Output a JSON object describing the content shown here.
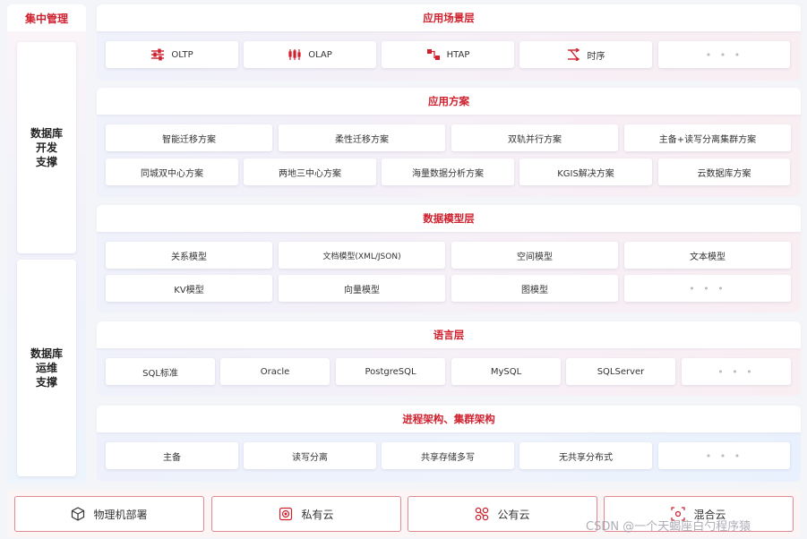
{
  "left": {
    "header": "集中管理",
    "dev_support": "数据库\n开发\n支撑",
    "ops_support": "数据库\n运维\n支撑"
  },
  "scenario_layer": {
    "title": "应用场景层",
    "items": [
      {
        "label": "OLTP",
        "icon": "sliders-icon"
      },
      {
        "label": "OLAP",
        "icon": "candlestick-icon"
      },
      {
        "label": "HTAP",
        "icon": "flow-icon"
      },
      {
        "label": "时序",
        "icon": "shuffle-icon"
      },
      {
        "label": "• • •",
        "icon": ""
      }
    ]
  },
  "solution_layer": {
    "title": "应用方案",
    "row1": [
      "智能迁移方案",
      "柔性迁移方案",
      "双轨并行方案",
      "主备+读写分离集群方案"
    ],
    "row2": [
      "同城双中心方案",
      "两地三中心方案",
      "海量数据分析方案",
      "KGIS解决方案",
      "云数据库方案"
    ]
  },
  "model_layer": {
    "title": "数据模型层",
    "row1": [
      "关系模型",
      "文档模型(XML/JSON)",
      "空间模型",
      "文本模型"
    ],
    "row2": [
      "KV模型",
      "向量模型",
      "图模型",
      "• • •"
    ]
  },
  "language_layer": {
    "title": "语言层",
    "items": [
      "SQL标准",
      "Oracle",
      "PostgreSQL",
      "MySQL",
      "SQLServer",
      "• • •"
    ]
  },
  "arch_layer": {
    "title": "进程架构、集群架构",
    "items": [
      "主备",
      "读写分离",
      "共享存储多写",
      "无共享分布式",
      "• • •"
    ]
  },
  "deploy": [
    {
      "label": "物理机部署",
      "icon": "cube-icon"
    },
    {
      "label": "私有云",
      "icon": "private-cloud-icon"
    },
    {
      "label": "公有云",
      "icon": "public-cloud-icon"
    },
    {
      "label": "混合云",
      "icon": "hybrid-cloud-icon"
    }
  ],
  "watermark": "CSDN @一个天蝎座白勺程序猿",
  "colors": {
    "accent": "#d0202e",
    "border_red": "#e08a8f"
  }
}
